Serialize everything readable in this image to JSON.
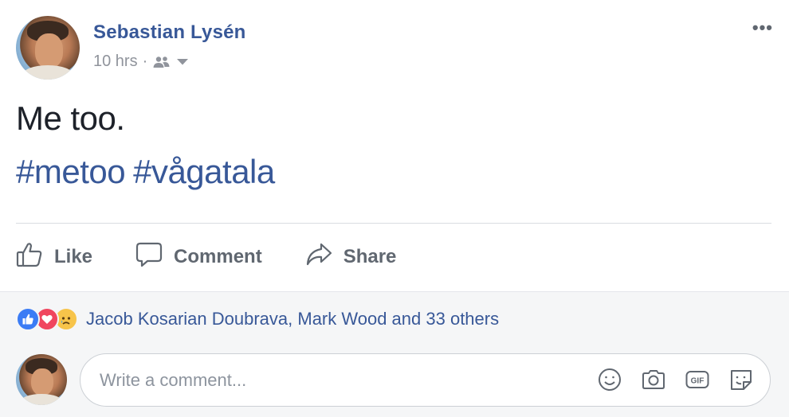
{
  "post": {
    "author": "Sebastian Lysén",
    "timestamp": "10 hrs",
    "separator": "·",
    "audience_icon": "friends-icon",
    "more_label": "•••",
    "text": "Me too.",
    "hashtags": [
      "#metoo",
      "#vågatala"
    ]
  },
  "actions": {
    "like_label": "Like",
    "comment_label": "Comment",
    "share_label": "Share"
  },
  "reactions": {
    "types": [
      "like",
      "love",
      "sad"
    ],
    "summary": "Jacob Kosarian Doubrava, Mark Wood and 33 others"
  },
  "comment": {
    "placeholder": "Write a comment...",
    "tools": [
      "emoji-icon",
      "camera-icon",
      "gif-icon",
      "sticker-icon"
    ]
  },
  "colors": {
    "link_blue": "#385898",
    "muted_gray": "#90949c",
    "action_gray": "#606770",
    "like_blue": "#3b7cf5",
    "love_red": "#f0465f",
    "sad_yellow": "#f7c44a",
    "lower_bg": "#f5f6f7"
  }
}
